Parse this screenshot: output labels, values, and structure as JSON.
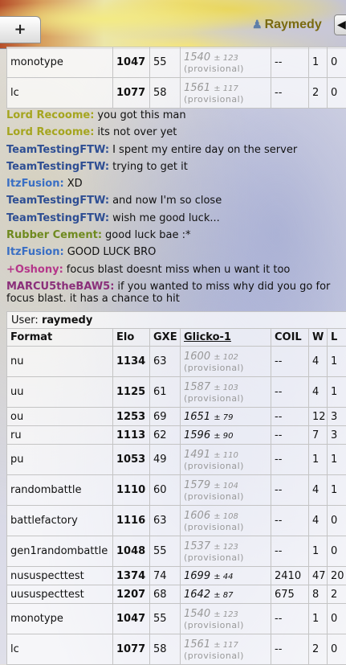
{
  "header": {
    "add_tab_label": "+",
    "username": "Raymedy"
  },
  "top_table": {
    "rows": [
      {
        "format": "monotype",
        "elo": "1047",
        "gxe": "55",
        "glicko": "1540",
        "dev": "± 123",
        "provisional": "(provisional)",
        "coil": "--",
        "w": "1",
        "l": "0"
      },
      {
        "format": "lc",
        "elo": "1077",
        "gxe": "58",
        "glicko": "1561",
        "dev": "± 117",
        "provisional": "(provisional)",
        "coil": "--",
        "w": "2",
        "l": "0"
      }
    ]
  },
  "chat": [
    {
      "name": "Lord Recoome:",
      "color": "#a5a51f",
      "message": "you got this man"
    },
    {
      "name": "Lord Recoome:",
      "color": "#a5a51f",
      "message": "its not over yet"
    },
    {
      "name": "TeamTestingFTW:",
      "color": "#2e4e93",
      "message": "I spent my entire day on the server"
    },
    {
      "name": "TeamTestingFTW:",
      "color": "#2e4e93",
      "message": "trying to get it"
    },
    {
      "name": "ItzFusion:",
      "color": "#3a6fc4",
      "message": "XD"
    },
    {
      "name": "TeamTestingFTW:",
      "color": "#2e4e93",
      "message": "and now I'm so close"
    },
    {
      "name": "TeamTestingFTW:",
      "color": "#2e4e93",
      "message": "wish me good luck..."
    },
    {
      "name": "Rubber Cement:",
      "color": "#6f8a1f",
      "message": "good luck bae :*"
    },
    {
      "name": "ItzFusion:",
      "color": "#3a6fc4",
      "message": "GOOD LUCK BRO"
    },
    {
      "name": "+Oshony:",
      "color": "#b5378a",
      "message": "focus blast doesnt miss when u want it too"
    },
    {
      "name": "MARCU5theBAW5:",
      "color": "#8a2f7a",
      "message": "if you wanted to miss why did you go for focus blast. it has a chance to hit"
    }
  ],
  "user_box": {
    "label": "User:",
    "username": "raymedy"
  },
  "stats": {
    "headers": [
      "Format",
      "Elo",
      "GXE",
      "Glicko-1",
      "COIL",
      "W",
      "L"
    ],
    "rows": [
      {
        "format": "nu",
        "elo": "1134",
        "gxe": "63",
        "glicko": "1600",
        "dev": "± 102",
        "provisional": "(provisional)",
        "coil": "--",
        "w": "4",
        "l": "1"
      },
      {
        "format": "uu",
        "elo": "1125",
        "gxe": "61",
        "glicko": "1587",
        "dev": "± 103",
        "provisional": "(provisional)",
        "coil": "--",
        "w": "4",
        "l": "1"
      },
      {
        "format": "ou",
        "elo": "1253",
        "gxe": "69",
        "glicko": "1651",
        "dev": "± 79",
        "provisional": "",
        "coil": "--",
        "w": "12",
        "l": "3"
      },
      {
        "format": "ru",
        "elo": "1113",
        "gxe": "62",
        "glicko": "1596",
        "dev": "± 90",
        "provisional": "",
        "coil": "--",
        "w": "7",
        "l": "3"
      },
      {
        "format": "pu",
        "elo": "1053",
        "gxe": "49",
        "glicko": "1491",
        "dev": "± 110",
        "provisional": "(provisional)",
        "coil": "--",
        "w": "1",
        "l": "1"
      },
      {
        "format": "randombattle",
        "elo": "1110",
        "gxe": "60",
        "glicko": "1579",
        "dev": "± 104",
        "provisional": "(provisional)",
        "coil": "--",
        "w": "4",
        "l": "1"
      },
      {
        "format": "battlefactory",
        "elo": "1116",
        "gxe": "63",
        "glicko": "1606",
        "dev": "± 108",
        "provisional": "(provisional)",
        "coil": "--",
        "w": "4",
        "l": "0"
      },
      {
        "format": "gen1randombattle",
        "elo": "1048",
        "gxe": "55",
        "glicko": "1537",
        "dev": "± 123",
        "provisional": "(provisional)",
        "coil": "--",
        "w": "1",
        "l": "0"
      },
      {
        "format": "nususpecttest",
        "elo": "1374",
        "gxe": "74",
        "glicko": "1699",
        "dev": "± 44",
        "provisional": "",
        "coil": "2410",
        "w": "47",
        "l": "20"
      },
      {
        "format": "uususpecttest",
        "elo": "1207",
        "gxe": "68",
        "glicko": "1642",
        "dev": "± 87",
        "provisional": "",
        "coil": "675",
        "w": "8",
        "l": "2"
      },
      {
        "format": "monotype",
        "elo": "1047",
        "gxe": "55",
        "glicko": "1540",
        "dev": "± 123",
        "provisional": "(provisional)",
        "coil": "--",
        "w": "1",
        "l": "0"
      },
      {
        "format": "lc",
        "elo": "1077",
        "gxe": "58",
        "glicko": "1561",
        "dev": "± 117",
        "provisional": "(provisional)",
        "coil": "--",
        "w": "2",
        "l": "0"
      }
    ]
  }
}
